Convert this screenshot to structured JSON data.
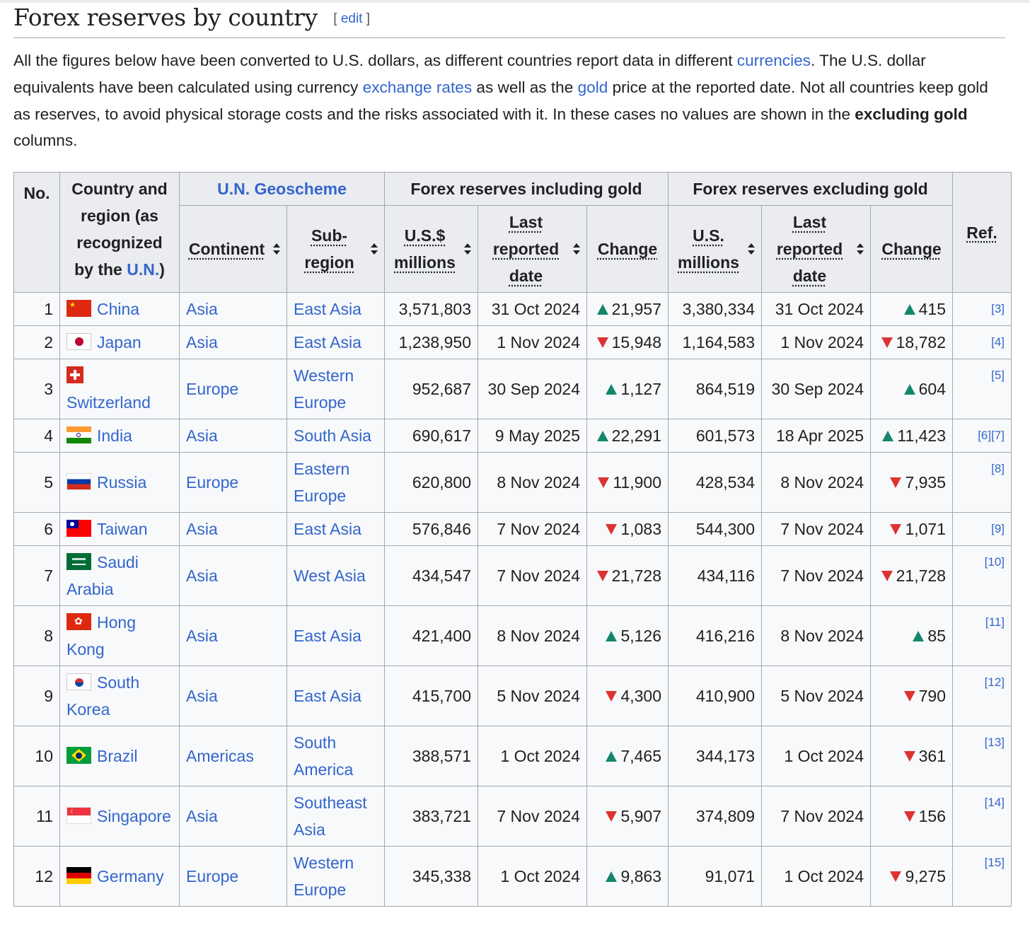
{
  "section": {
    "title": "Forex reserves by country",
    "edit_open": "[",
    "edit_label": "edit",
    "edit_close": "]"
  },
  "intro": {
    "p1": "All the figures below have been converted to U.S. dollars, as different countries report data in different ",
    "link_currencies": "currencies",
    "p2": ". The U.S. dollar equivalents have been calculated using currency ",
    "link_exchange": "exchange rates",
    "p3": " as well as the ",
    "link_gold": "gold",
    "p4": " price at the reported date. Not all countries keep gold as reserves, to avoid physical storage costs and the risks associated with it. In these cases no values are shown in the ",
    "bold": "excluding gold",
    "p5": " columns."
  },
  "table": {
    "h_no": "No.",
    "h_country_pre": "Country and region (as recognized by the ",
    "h_country_link": "U.N.",
    "h_country_post": ")",
    "h_geoscheme": "U.N. Geoscheme",
    "h_incl": "Forex reserves including gold",
    "h_excl": "Forex reserves excluding gold",
    "h_ref": "Ref.",
    "h_continent": "Continent",
    "h_subregion": "Sub-region",
    "h_usd_incl": "U.S.$ millions",
    "h_date_incl": "Last reported date",
    "h_change_incl": "Change",
    "h_usd_excl": "U.S. millions",
    "h_date_excl": "Last reported date",
    "h_change_excl": "Change"
  },
  "rows": [
    {
      "no": "1",
      "country": "China",
      "continent": "Asia",
      "subregion": "East Asia",
      "incl": "3,571,803",
      "date_incl": "31 Oct 2024",
      "dir_incl": "up",
      "chg_incl": "21,957",
      "excl": "3,380,334",
      "date_excl": "31 Oct 2024",
      "dir_excl": "up",
      "chg_excl": "415",
      "ref": "[3]"
    },
    {
      "no": "2",
      "country": "Japan",
      "continent": "Asia",
      "subregion": "East Asia",
      "incl": "1,238,950",
      "date_incl": "1 Nov 2024",
      "dir_incl": "down",
      "chg_incl": "15,948",
      "excl": "1,164,583",
      "date_excl": "1 Nov 2024",
      "dir_excl": "down",
      "chg_excl": "18,782",
      "ref": "[4]"
    },
    {
      "no": "3",
      "country": "Switzerland",
      "continent": "Europe",
      "subregion": "Western Europe",
      "incl": "952,687",
      "date_incl": "30 Sep 2024",
      "dir_incl": "up",
      "chg_incl": "1,127",
      "excl": "864,519",
      "date_excl": "30 Sep 2024",
      "dir_excl": "up",
      "chg_excl": "604",
      "ref": "[5]"
    },
    {
      "no": "4",
      "country": "India",
      "continent": "Asia",
      "subregion": "South Asia",
      "incl": "690,617",
      "date_incl": "9 May 2025",
      "dir_incl": "up",
      "chg_incl": "22,291",
      "excl": "601,573",
      "date_excl": "18 Apr 2025",
      "dir_excl": "up",
      "chg_excl": "11,423",
      "ref": "[6][7]"
    },
    {
      "no": "5",
      "country": "Russia",
      "continent": "Europe",
      "subregion": "Eastern Europe",
      "incl": "620,800",
      "date_incl": "8 Nov 2024",
      "dir_incl": "down",
      "chg_incl": "11,900",
      "excl": "428,534",
      "date_excl": "8 Nov 2024",
      "dir_excl": "down",
      "chg_excl": "7,935",
      "ref": "[8]"
    },
    {
      "no": "6",
      "country": "Taiwan",
      "continent": "Asia",
      "subregion": "East Asia",
      "incl": "576,846",
      "date_incl": "7 Nov 2024",
      "dir_incl": "down",
      "chg_incl": "1,083",
      "excl": "544,300",
      "date_excl": "7 Nov 2024",
      "dir_excl": "down",
      "chg_excl": "1,071",
      "ref": "[9]"
    },
    {
      "no": "7",
      "country": "Saudi Arabia",
      "continent": "Asia",
      "subregion": "West Asia",
      "incl": "434,547",
      "date_incl": "7 Nov 2024",
      "dir_incl": "down",
      "chg_incl": "21,728",
      "excl": "434,116",
      "date_excl": "7 Nov 2024",
      "dir_excl": "down",
      "chg_excl": "21,728",
      "ref": "[10]"
    },
    {
      "no": "8",
      "country": "Hong Kong",
      "continent": "Asia",
      "subregion": "East Asia",
      "incl": "421,400",
      "date_incl": "8 Nov 2024",
      "dir_incl": "up",
      "chg_incl": "5,126",
      "excl": "416,216",
      "date_excl": "8 Nov 2024",
      "dir_excl": "up",
      "chg_excl": "85",
      "ref": "[11]"
    },
    {
      "no": "9",
      "country": "South Korea",
      "continent": "Asia",
      "subregion": "East Asia",
      "incl": "415,700",
      "date_incl": "5 Nov 2024",
      "dir_incl": "down",
      "chg_incl": "4,300",
      "excl": "410,900",
      "date_excl": "5 Nov 2024",
      "dir_excl": "down",
      "chg_excl": "790",
      "ref": "[12]"
    },
    {
      "no": "10",
      "country": "Brazil",
      "continent": "Americas",
      "subregion": "South America",
      "incl": "388,571",
      "date_incl": "1 Oct 2024",
      "dir_incl": "up",
      "chg_incl": "7,465",
      "excl": "344,173",
      "date_excl": "1 Oct 2024",
      "dir_excl": "down",
      "chg_excl": "361",
      "ref": "[13]"
    },
    {
      "no": "11",
      "country": "Singapore",
      "continent": "Asia",
      "subregion": "Southeast Asia",
      "incl": "383,721",
      "date_incl": "7 Nov 2024",
      "dir_incl": "down",
      "chg_incl": "5,907",
      "excl": "374,809",
      "date_excl": "7 Nov 2024",
      "dir_excl": "down",
      "chg_excl": "156",
      "ref": "[14]"
    },
    {
      "no": "12",
      "country": "Germany",
      "continent": "Europe",
      "subregion": "Western Europe",
      "incl": "345,338",
      "date_incl": "1 Oct 2024",
      "dir_incl": "up",
      "chg_incl": "9,863",
      "excl": "91,071",
      "date_excl": "1 Oct 2024",
      "dir_excl": "down",
      "chg_excl": "9,275",
      "ref": "[15]"
    }
  ],
  "colors": {
    "link": "#3366cc",
    "up": "#14866d",
    "down": "#dd3333",
    "header_bg": "#eaecf0",
    "cell_bg": "#f8f9fa"
  }
}
